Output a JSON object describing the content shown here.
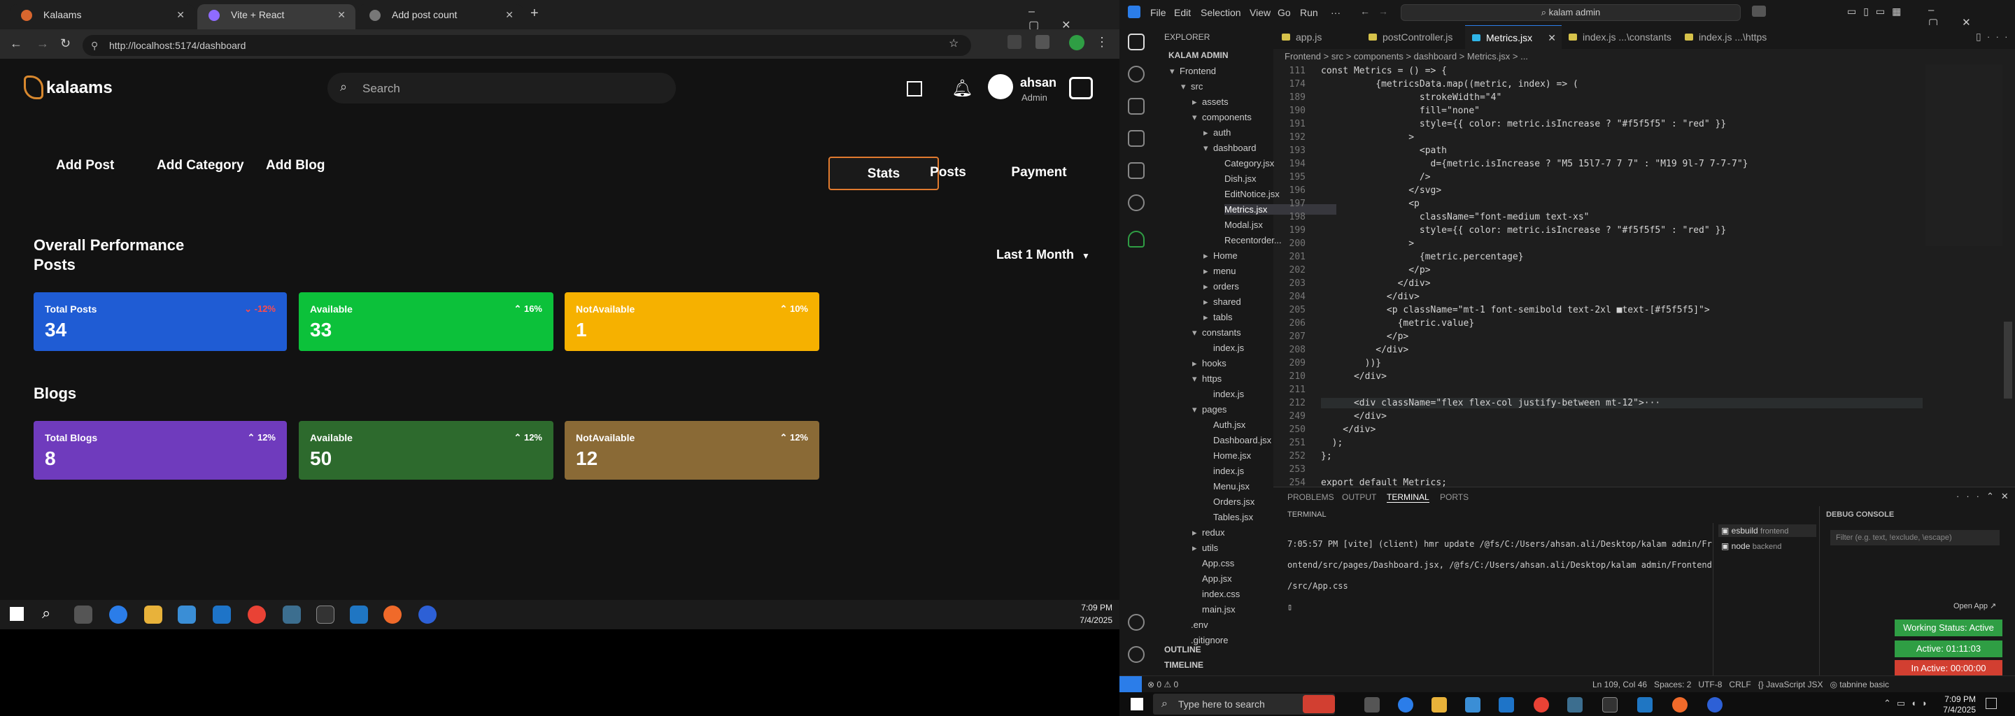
{
  "browser": {
    "tabs": [
      {
        "title": "Kalaams",
        "color": "#d8662e"
      },
      {
        "title": "Vite + React",
        "color": "#8f6bff"
      },
      {
        "title": "Add post count",
        "color": "#aaaaaa"
      }
    ],
    "url": "http://localhost:5174/dashboard"
  },
  "site": {
    "logo": "kalaams",
    "search_placeholder": "Search",
    "user": {
      "name": "ahsan",
      "role": "Admin"
    },
    "nav": [
      "Add Post",
      "Add Category",
      "Add Blog"
    ],
    "stat_tabs": [
      "Stats",
      "Posts",
      "Payment"
    ],
    "range_select": "Last 1 Month",
    "heading": "Overall Performance",
    "posts_heading": "Posts",
    "blogs_heading": "Blogs",
    "posts_cards": [
      {
        "label": "Total Posts",
        "value": "34",
        "pct": "-12%",
        "color": "#1f5cd4",
        "pct_color": "#ff4b4b"
      },
      {
        "label": "Available",
        "value": "33",
        "pct": "16%",
        "color": "#0cc13a",
        "pct_color": "#ffffff"
      },
      {
        "label": "NotAvailable",
        "value": "1",
        "pct": "10%",
        "color": "#f6b100",
        "pct_color": "#ffffff"
      }
    ],
    "blogs_cards": [
      {
        "label": "Total Blogs",
        "value": "8",
        "pct": "12%",
        "color": "#6f3bbd",
        "pct_color": "#ffffff"
      },
      {
        "label": "Available",
        "value": "50",
        "pct": "12%",
        "color": "#2d6a2d",
        "pct_color": "#ffffff"
      },
      {
        "label": "NotAvailable",
        "value": "12",
        "pct": "12%",
        "color": "#8a6a36",
        "pct_color": "#ffffff"
      }
    ],
    "taskbar_time": "7:09 PM",
    "taskbar_date": "7/4/2025"
  },
  "vscode": {
    "menus": [
      "File",
      "Edit",
      "Selection",
      "View",
      "Go",
      "Run",
      "···"
    ],
    "command_center": "kalam admin",
    "explorer_title": "EXPLORER",
    "project": "KALAM ADMIN",
    "tree": [
      {
        "label": "Frontend",
        "depth": 0,
        "type": "open"
      },
      {
        "label": "src",
        "depth": 1,
        "type": "open"
      },
      {
        "label": "assets",
        "depth": 2,
        "type": "closed"
      },
      {
        "label": "components",
        "depth": 2,
        "type": "open"
      },
      {
        "label": "auth",
        "depth": 3,
        "type": "closed"
      },
      {
        "label": "dashboard",
        "depth": 3,
        "type": "open"
      },
      {
        "label": "Category.jsx",
        "depth": 4,
        "type": "file"
      },
      {
        "label": "Dish.jsx",
        "depth": 4,
        "type": "file"
      },
      {
        "label": "EditNotice.jsx",
        "depth": 4,
        "type": "file"
      },
      {
        "label": "Metrics.jsx",
        "depth": 4,
        "type": "file",
        "active": true
      },
      {
        "label": "Modal.jsx",
        "depth": 4,
        "type": "file"
      },
      {
        "label": "Recentorder...",
        "depth": 4,
        "type": "file"
      },
      {
        "label": "Home",
        "depth": 3,
        "type": "closed"
      },
      {
        "label": "menu",
        "depth": 3,
        "type": "closed"
      },
      {
        "label": "orders",
        "depth": 3,
        "type": "closed"
      },
      {
        "label": "shared",
        "depth": 3,
        "type": "closed"
      },
      {
        "label": "tabls",
        "depth": 3,
        "type": "closed"
      },
      {
        "label": "constants",
        "depth": 2,
        "type": "open"
      },
      {
        "label": "index.js",
        "depth": 3,
        "type": "file"
      },
      {
        "label": "hooks",
        "depth": 2,
        "type": "closed"
      },
      {
        "label": "https",
        "depth": 2,
        "type": "open"
      },
      {
        "label": "index.js",
        "depth": 3,
        "type": "file"
      },
      {
        "label": "pages",
        "depth": 2,
        "type": "open"
      },
      {
        "label": "Auth.jsx",
        "depth": 3,
        "type": "file"
      },
      {
        "label": "Dashboard.jsx",
        "depth": 3,
        "type": "file"
      },
      {
        "label": "Home.jsx",
        "depth": 3,
        "type": "file"
      },
      {
        "label": "index.js",
        "depth": 3,
        "type": "file"
      },
      {
        "label": "Menu.jsx",
        "depth": 3,
        "type": "file"
      },
      {
        "label": "Orders.jsx",
        "depth": 3,
        "type": "file"
      },
      {
        "label": "Tables.jsx",
        "depth": 3,
        "type": "file"
      },
      {
        "label": "redux",
        "depth": 2,
        "type": "closed"
      },
      {
        "label": "utils",
        "depth": 2,
        "type": "closed"
      },
      {
        "label": "App.css",
        "depth": 2,
        "type": "file"
      },
      {
        "label": "App.jsx",
        "depth": 2,
        "type": "file"
      },
      {
        "label": "index.css",
        "depth": 2,
        "type": "file"
      },
      {
        "label": "main.jsx",
        "depth": 2,
        "type": "file"
      },
      {
        "label": ".env",
        "depth": 1,
        "type": "file"
      },
      {
        "label": ".gitignore",
        "depth": 1,
        "type": "file"
      }
    ],
    "outline": "OUTLINE",
    "timeline": "TIMELINE",
    "editor_tabs": [
      "app.js",
      "postController.js",
      "Metrics.jsx",
      "index.js ...\\constants",
      "index.js ...\\https"
    ],
    "breadcrumb": "Frontend > src > components > dashboard > Metrics.jsx > ...",
    "code": [
      {
        "n": "111",
        "t": "const Metrics = () => {"
      },
      {
        "n": "174",
        "t": "          {metricsData.map((metric, index) => ("
      },
      {
        "n": "189",
        "t": "                  strokeWidth=\"4\""
      },
      {
        "n": "190",
        "t": "                  fill=\"none\""
      },
      {
        "n": "191",
        "t": "                  style={{ color: metric.isIncrease ? \"#f5f5f5\" : \"red\" }}"
      },
      {
        "n": "192",
        "t": "                >"
      },
      {
        "n": "193",
        "t": "                  <path"
      },
      {
        "n": "194",
        "t": "                    d={metric.isIncrease ? \"M5 15l7-7 7 7\" : \"M19 9l-7 7-7-7\"}"
      },
      {
        "n": "195",
        "t": "                  />"
      },
      {
        "n": "196",
        "t": "                </svg>"
      },
      {
        "n": "197",
        "t": "                <p"
      },
      {
        "n": "198",
        "t": "                  className=\"font-medium text-xs\""
      },
      {
        "n": "199",
        "t": "                  style={{ color: metric.isIncrease ? \"#f5f5f5\" : \"red\" }}"
      },
      {
        "n": "200",
        "t": "                >"
      },
      {
        "n": "201",
        "t": "                  {metric.percentage}"
      },
      {
        "n": "202",
        "t": "                </p>"
      },
      {
        "n": "203",
        "t": "              </div>"
      },
      {
        "n": "204",
        "t": "            </div>"
      },
      {
        "n": "205",
        "t": "            <p className=\"mt-1 font-semibold text-2xl ■text-[#f5f5f5]\">"
      },
      {
        "n": "206",
        "t": "              {metric.value}"
      },
      {
        "n": "207",
        "t": "            </p>"
      },
      {
        "n": "208",
        "t": "          </div>"
      },
      {
        "n": "209",
        "t": "        ))}"
      },
      {
        "n": "210",
        "t": "      </div>"
      },
      {
        "n": "211",
        "t": ""
      },
      {
        "n": "212",
        "t": "      <div className=\"flex flex-col justify-between mt-12\">···"
      },
      {
        "n": "249",
        "t": "      </div>"
      },
      {
        "n": "250",
        "t": "    </div>"
      },
      {
        "n": "251",
        "t": "  );"
      },
      {
        "n": "252",
        "t": "};"
      },
      {
        "n": "253",
        "t": ""
      },
      {
        "n": "254",
        "t": "export default Metrics;"
      }
    ],
    "panel_tabs": [
      "PROBLEMS",
      "OUTPUT",
      "TERMINAL",
      "PORTS"
    ],
    "terminal_label": "TERMINAL",
    "terminal_lines": [
      "7:05:57 PM [vite] (client) hmr update /@fs/C:/Users/ahsan.ali/Desktop/kalam admin/Fr",
      "ontend/src/pages/Dashboard.jsx, /@fs/C:/Users/ahsan.ali/Desktop/kalam admin/Frontend",
      "/src/App.css"
    ],
    "terminals": [
      {
        "name": "esbuild",
        "detail": "frontend"
      },
      {
        "name": "node",
        "detail": "backend"
      }
    ],
    "debug_console": "DEBUG CONSOLE",
    "debug_filter": "Filter (e.g. text, !exclude, \\escape)",
    "open_app": "Open App ↗",
    "badges": [
      {
        "text": "Working Status: Active",
        "color": "#2f9e44"
      },
      {
        "text": "Active: 01:11:03",
        "color": "#2f9e44"
      },
      {
        "text": "In Active: 00:00:00",
        "color": "#d23f31"
      }
    ],
    "status_left": "⊗ 0 ⚠ 0",
    "status_right": "Ln 109, Col 46   Spaces: 2   UTF-8   CRLF   {} JavaScript JSX   ◎ tabnine basic",
    "search_placeholder": "Type here to search",
    "time": "7:09 PM",
    "date": "7/4/2025"
  }
}
